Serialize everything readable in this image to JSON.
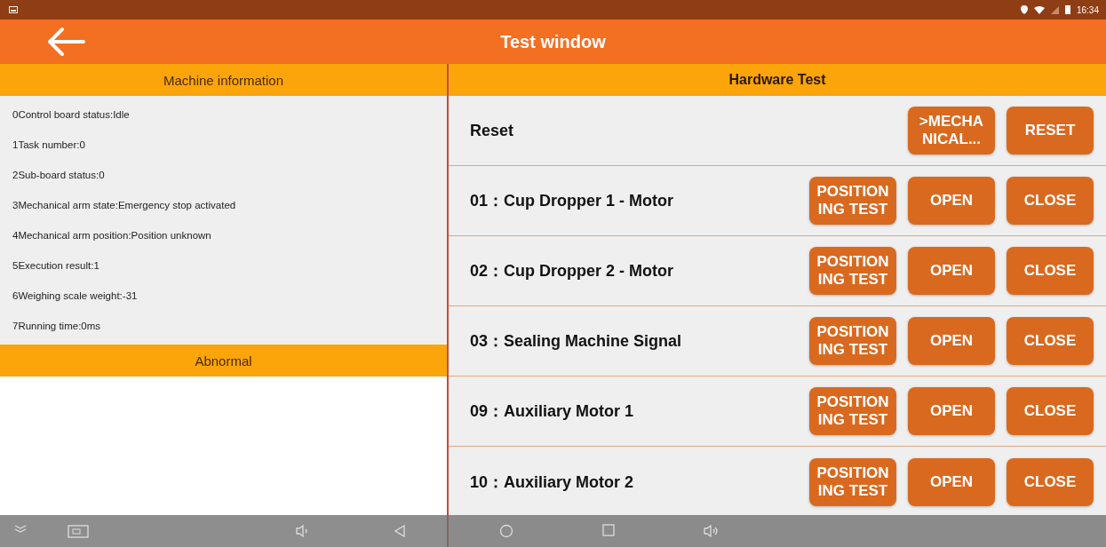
{
  "status_bar": {
    "time": "16:34"
  },
  "title": "Test window",
  "machine_info": {
    "heading": "Machine information",
    "items": [
      "0Control board status:Idle",
      "1Task number:0",
      "2Sub-board status:0",
      "3Mechanical arm state:Emergency stop activated",
      "4Mechanical arm position:Position unknown",
      "5Execution result:1",
      "6Weighing scale weight:-31",
      "7Running time:0ms"
    ]
  },
  "abnormal": {
    "heading": "Abnormal"
  },
  "hardware_test": {
    "heading": "Hardware Test",
    "rows": [
      {
        "label": "Reset",
        "buttons": [
          ">MECHANICAL...",
          "RESET"
        ]
      },
      {
        "label": "01：Cup Dropper 1 - Motor",
        "buttons": [
          "POSITIONING TEST",
          "OPEN",
          "CLOSE"
        ]
      },
      {
        "label": "02：Cup Dropper 2 - Motor",
        "buttons": [
          "POSITIONING TEST",
          "OPEN",
          "CLOSE"
        ]
      },
      {
        "label": "03：Sealing Machine Signal",
        "buttons": [
          "POSITIONING TEST",
          "OPEN",
          "CLOSE"
        ]
      },
      {
        "label": "09：Auxiliary Motor 1",
        "buttons": [
          "POSITIONING TEST",
          "OPEN",
          "CLOSE"
        ]
      },
      {
        "label": "10：Auxiliary Motor 2",
        "buttons": [
          "POSITIONING TEST",
          "OPEN",
          "CLOSE"
        ]
      }
    ]
  }
}
